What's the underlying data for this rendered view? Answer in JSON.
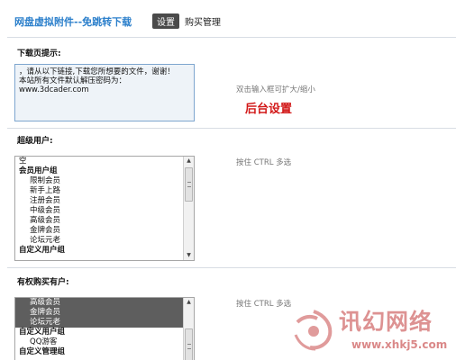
{
  "header": {
    "title": "网盘虚拟附件--免跳转下载",
    "tabs": [
      {
        "label": "设置",
        "active": true
      },
      {
        "label": "购买管理",
        "active": false
      }
    ]
  },
  "download_tip": {
    "label": "下载页提示:",
    "text_lines": [
      "，请从以下链接,下载您所想要的文件，谢谢！",
      "本站所有文件默认解压密码为：",
      "www.3dcader.com"
    ],
    "hint": "双击输入框可扩大/缩小"
  },
  "annotation": "后台设置",
  "super_users": {
    "label": "超级用户:",
    "hint": "按住 CTRL 多选",
    "options": [
      {
        "text": "空",
        "level": "top",
        "selected": false
      },
      {
        "text": "会员用户组",
        "level": "group",
        "selected": false
      },
      {
        "text": "限制会员",
        "level": "child",
        "selected": false
      },
      {
        "text": "新手上路",
        "level": "child",
        "selected": false
      },
      {
        "text": "注册会员",
        "level": "child",
        "selected": false
      },
      {
        "text": "中级会员",
        "level": "child",
        "selected": false
      },
      {
        "text": "高级会员",
        "level": "child",
        "selected": false
      },
      {
        "text": "金牌会员",
        "level": "child",
        "selected": false
      },
      {
        "text": "论坛元老",
        "level": "child",
        "selected": false
      },
      {
        "text": "自定义用户组",
        "level": "group",
        "selected": false
      }
    ]
  },
  "buy_permission": {
    "label": "有权购买有户:",
    "hint": "按住 CTRL 多选",
    "options": [
      {
        "text": "高级会员",
        "level": "child",
        "selected": true
      },
      {
        "text": "金牌会员",
        "level": "child",
        "selected": true
      },
      {
        "text": "论坛元老",
        "level": "child",
        "selected": true
      },
      {
        "text": "自定义用户组",
        "level": "group",
        "selected": false
      },
      {
        "text": "QQ游客",
        "level": "child",
        "selected": false
      },
      {
        "text": "自定义管理组",
        "level": "group",
        "selected": false
      }
    ]
  },
  "watermark": {
    "text": "讯幻网络",
    "url": "www.xhkj5.com"
  },
  "icons": {
    "scroll_up": "scroll-up-arrow-icon",
    "scroll_down": "scroll-down-arrow-icon",
    "watermark_logo": "watermark-logo-icon"
  },
  "colors": {
    "title": "#2b7fcb",
    "active_tab": "#4a4a4a",
    "annotation": "#d21818",
    "selected_option": "#5e5e5e",
    "textarea_bg": "#eef3f8",
    "watermark": "#c23a3a"
  }
}
